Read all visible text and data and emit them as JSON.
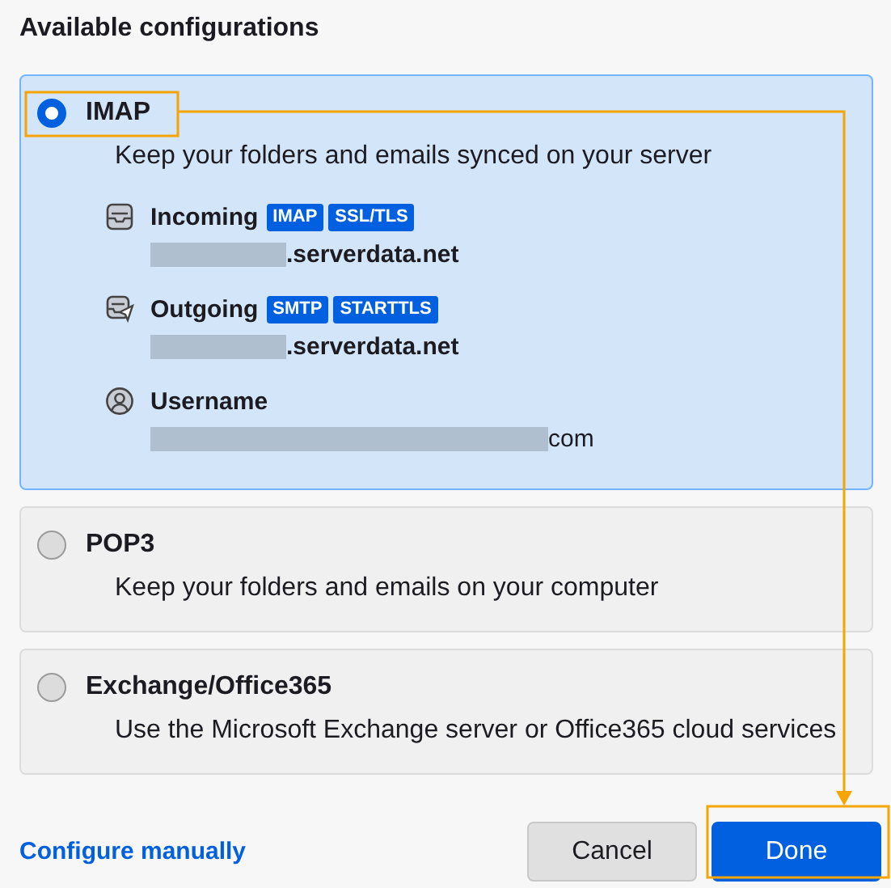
{
  "heading": "Available configurations",
  "options": [
    {
      "title": "IMAP",
      "description": "Keep your folders and emails synced on your server",
      "selected": true,
      "servers": [
        {
          "kind": "incoming",
          "label": "Incoming",
          "tags": [
            "IMAP",
            "SSL/TLS"
          ],
          "value": ".serverdata.net"
        },
        {
          "kind": "outgoing",
          "label": "Outgoing",
          "tags": [
            "SMTP",
            "STARTTLS"
          ],
          "value": ".serverdata.net"
        },
        {
          "kind": "username",
          "label": "Username",
          "value": "com"
        }
      ]
    },
    {
      "title": "POP3",
      "description": "Keep your folders and emails on your computer",
      "selected": false
    },
    {
      "title": "Exchange/Office365",
      "description": "Use the Microsoft Exchange server or Office365 cloud services",
      "selected": false
    }
  ],
  "link": "Configure manually",
  "buttons": [
    {
      "label": "Cancel",
      "kind": "secondary"
    },
    {
      "label": "Done",
      "kind": "primary"
    }
  ]
}
